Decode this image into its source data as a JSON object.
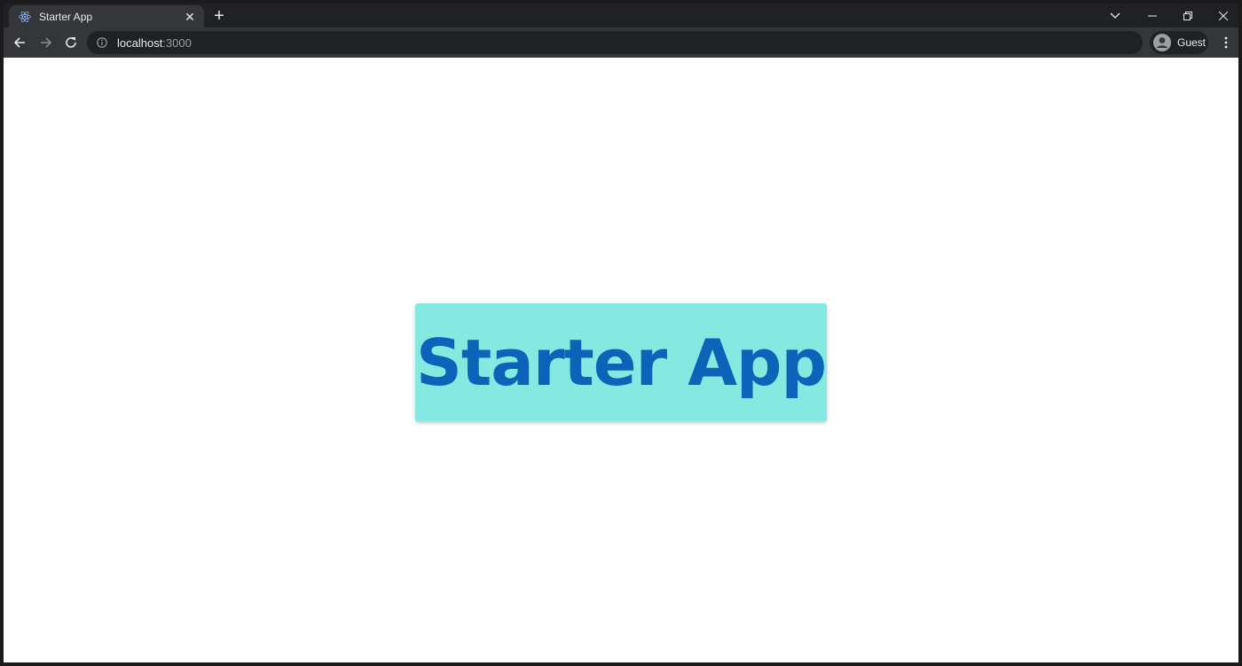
{
  "browser": {
    "tab": {
      "title": "Starter App",
      "favicon": "react-logo-icon"
    },
    "address": {
      "host": "localhost",
      "port": ":3000"
    },
    "profile": {
      "label": "Guest"
    }
  },
  "page": {
    "heading": "Starter App",
    "colors": {
      "panel": "#86e9e1",
      "heading": "#0d63b8",
      "background": "#ffffff"
    }
  }
}
